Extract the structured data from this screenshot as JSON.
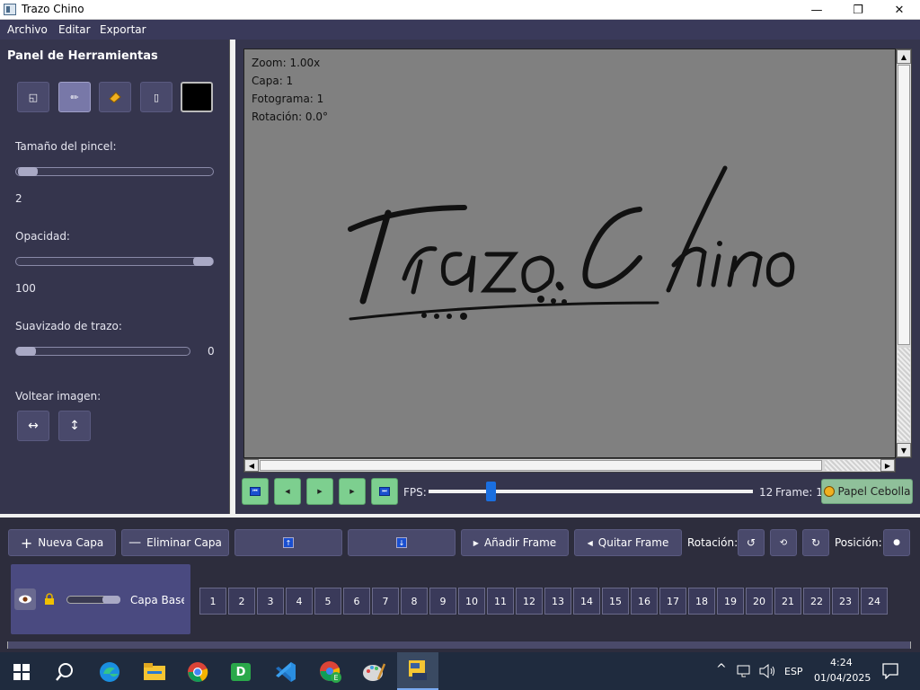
{
  "window": {
    "title": "Trazo Chino",
    "minimize": "—",
    "maximize": "❐",
    "close": "✕"
  },
  "menu": [
    "Archivo",
    "Editar",
    "Exportar"
  ],
  "tools_panel": {
    "title": "Panel de Herramientas",
    "tools": [
      "selection-icon",
      "pencil-icon",
      "eraser-icon",
      "bucket-icon"
    ],
    "active_tool": "pencil-icon",
    "color": "#000000",
    "brush_size": {
      "label": "Tamaño del pincel:",
      "value": "2",
      "fraction": 0.05
    },
    "opacity": {
      "label": "Opacidad:",
      "value": "100",
      "fraction": 1.0
    },
    "smoothing": {
      "label": "Suavizado de trazo:",
      "value": "0",
      "fraction": 0.0
    },
    "flip": {
      "label": "Voltear imagen:",
      "horizontal": "↔",
      "vertical": "↕"
    }
  },
  "canvas": {
    "zoom": "Zoom: 1.00x",
    "layer": "Capa: 1",
    "frame": "Fotograma: 1",
    "rotation": "Rotación: 0.0°",
    "logo_text": "Trazo Chino"
  },
  "playback": {
    "fps_label": "FPS:",
    "fps_value": "12",
    "fps_fraction": 0.19,
    "frame_label": "Frame: 1",
    "onion": "Papel Cebolla"
  },
  "layers_toolbar": {
    "new_layer": "Nueva Capa",
    "delete_layer": "Eliminar Capa",
    "add_frame": "Añadir Frame",
    "remove_frame": "Quitar Frame",
    "rotation_label": "Rotación:",
    "position_label": "Posición:"
  },
  "layer": {
    "name": "Capa Base (",
    "opacity_fraction": 1.0
  },
  "frames": [
    "1",
    "2",
    "3",
    "4",
    "5",
    "6",
    "7",
    "8",
    "9",
    "10",
    "11",
    "12",
    "13",
    "14",
    "15",
    "16",
    "17",
    "18",
    "19",
    "20",
    "21",
    "22",
    "23",
    "24"
  ],
  "taskbar": {
    "apps": [
      "windows-start-icon",
      "search-icon",
      "edge-icon",
      "file-explorer-icon",
      "chrome-icon",
      "app-d-icon",
      "vscode-icon",
      "chrome-e-icon",
      "paint-palette-icon",
      "trazo-chino-app-icon"
    ],
    "language": "ESP",
    "time": "4:24",
    "date": "01/04/2025"
  }
}
